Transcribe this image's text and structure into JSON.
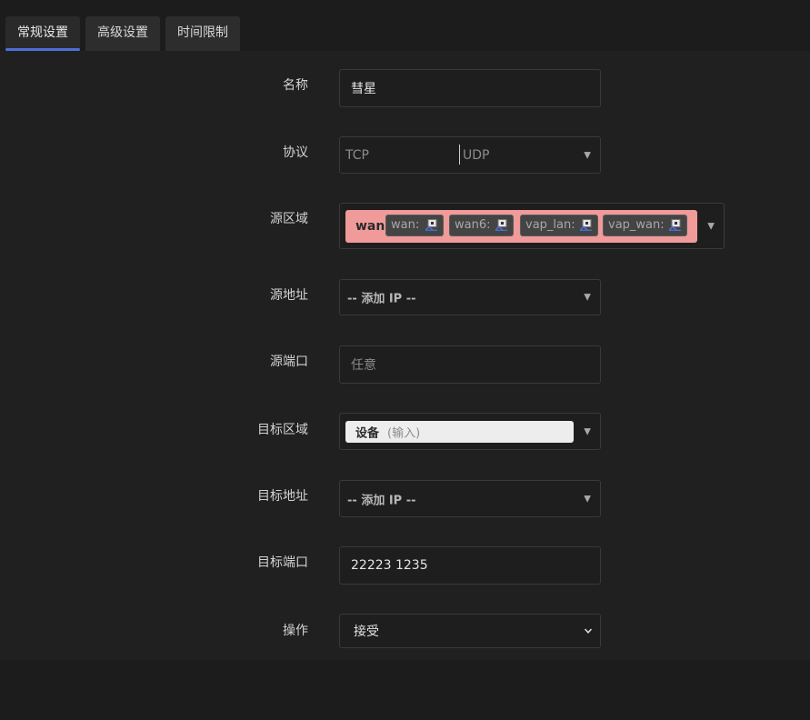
{
  "tabs": [
    {
      "label": "常规设置",
      "active": true
    },
    {
      "label": "高级设置",
      "active": false
    },
    {
      "label": "时间限制",
      "active": false
    }
  ],
  "form": {
    "name": {
      "label": "名称",
      "value": "彗星"
    },
    "protocol": {
      "label": "协议",
      "options": [
        "TCP",
        "UDP"
      ]
    },
    "source_zone": {
      "label": "源区域",
      "zone": "wan",
      "zone_color": "#f09a9a",
      "interfaces": [
        "wan:",
        "wan6:",
        "vap_lan:",
        "vap_wan:"
      ]
    },
    "source_address": {
      "label": "源地址",
      "value": "-- 添加 IP --"
    },
    "source_port": {
      "label": "源端口",
      "placeholder": "任意"
    },
    "dest_zone": {
      "label": "目标区域",
      "value": "设备",
      "hint": "(输入)"
    },
    "dest_address": {
      "label": "目标地址",
      "value": "-- 添加 IP --"
    },
    "dest_port": {
      "label": "目标端口",
      "value": "22223 1235"
    },
    "action": {
      "label": "操作",
      "value": "接受"
    }
  },
  "colors": {
    "accent": "#4f6fd8",
    "background": "#202020"
  }
}
